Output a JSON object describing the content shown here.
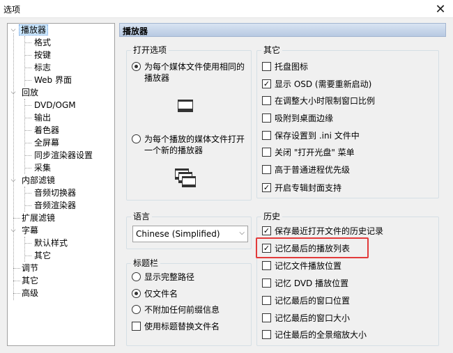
{
  "window": {
    "title": "选项"
  },
  "tree": {
    "items": [
      {
        "label": "播放器",
        "selected": true
      },
      {
        "label": "格式"
      },
      {
        "label": "按键"
      },
      {
        "label": "标志"
      },
      {
        "label": "Web 界面"
      },
      {
        "label": "回放"
      },
      {
        "label": "DVD/OGM"
      },
      {
        "label": "输出"
      },
      {
        "label": "着色器"
      },
      {
        "label": "全屏幕"
      },
      {
        "label": "同步渲染器设置"
      },
      {
        "label": "采集"
      },
      {
        "label": "内部滤镜"
      },
      {
        "label": "音频切换器"
      },
      {
        "label": "音频渲染器"
      },
      {
        "label": "扩展滤镜"
      },
      {
        "label": "字幕"
      },
      {
        "label": "默认样式"
      },
      {
        "label": "其它"
      },
      {
        "label": "调节"
      },
      {
        "label": "其它"
      },
      {
        "label": "高级"
      }
    ]
  },
  "panel": {
    "title": "播放器",
    "open_options": {
      "title": "打开选项",
      "options": [
        {
          "label": "为每个媒体文件使用相同的播放器",
          "checked": true
        },
        {
          "label": "为每个播放的媒体文件打开一个新的播放器",
          "checked": false
        }
      ]
    },
    "language": {
      "title": "语言",
      "value": "Chinese (Simplified)"
    },
    "titlebar": {
      "title": "标题栏",
      "radios": [
        {
          "label": "显示完整路径",
          "checked": false
        },
        {
          "label": "仅文件名",
          "checked": true
        },
        {
          "label": "不附加任何前缀信息",
          "checked": false
        }
      ],
      "checkbox": {
        "label": "使用标题替换文件名",
        "checked": false
      }
    },
    "other": {
      "title": "其它",
      "items": [
        {
          "label": "托盘图标",
          "checked": false
        },
        {
          "label": "显示 OSD (需要重新启动)",
          "checked": true
        },
        {
          "label": "在调整大小时限制窗口比例",
          "checked": false
        },
        {
          "label": "吸附到桌面边缘",
          "checked": false
        },
        {
          "label": "保存设置到 .ini 文件中",
          "checked": false
        },
        {
          "label": "关闭 \"打开光盘\" 菜单",
          "checked": false
        },
        {
          "label": "高于普通进程优先级",
          "checked": false
        },
        {
          "label": "开启专辑封面支持",
          "checked": true
        }
      ]
    },
    "history": {
      "title": "历史",
      "items": [
        {
          "label": "保存最近打开文件的历史记录",
          "checked": true
        },
        {
          "label": "记忆最后的播放列表",
          "checked": true
        },
        {
          "label": "记忆文件播放位置",
          "checked": false
        },
        {
          "label": "记忆 DVD 播放位置",
          "checked": false
        },
        {
          "label": "记忆最后的窗口位置",
          "checked": false
        },
        {
          "label": "记忆最后的窗口大小",
          "checked": false
        },
        {
          "label": "记住最后的全景缩放大小",
          "checked": false
        }
      ]
    }
  },
  "colors": {
    "highlight": "#e23a3a",
    "selection": "#cce8ff"
  }
}
